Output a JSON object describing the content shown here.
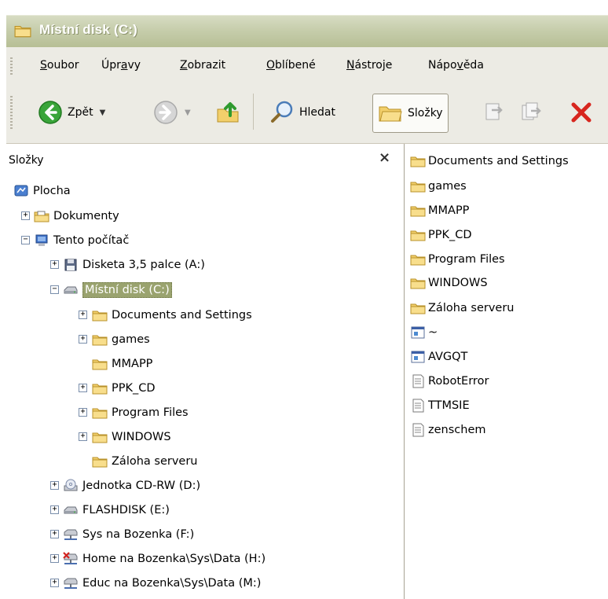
{
  "window": {
    "title": "Místní disk (C:)"
  },
  "menu": [
    {
      "pre": "",
      "u": "S",
      "post": "oubor"
    },
    {
      "pre": "Úpr",
      "u": "a",
      "post": "vy"
    },
    {
      "pre": "",
      "u": "Z",
      "post": "obrazit"
    },
    {
      "pre": "",
      "u": "O",
      "post": "blíbené"
    },
    {
      "pre": "",
      "u": "N",
      "post": "ástroje"
    },
    {
      "pre": "Nápo",
      "u": "v",
      "post": "ěda"
    }
  ],
  "toolbar": {
    "back_label": "Zpět",
    "search_label": "Hledat",
    "folders_label": "Složky"
  },
  "folders_pane": {
    "title": "Složky",
    "close": "×",
    "tree": [
      {
        "label": "Plocha"
      },
      {
        "label": "Dokumenty"
      },
      {
        "label": "Tento počítač"
      },
      {
        "label": "Disketa 3,5 palce (A:)"
      },
      {
        "label": "Místní disk (C:)"
      },
      {
        "label": "Documents and Settings"
      },
      {
        "label": "games"
      },
      {
        "label": "MMAPP"
      },
      {
        "label": "PPK_CD"
      },
      {
        "label": "Program Files"
      },
      {
        "label": "WINDOWS"
      },
      {
        "label": "Záloha serveru"
      },
      {
        "label": "Jednotka CD-RW (D:)"
      },
      {
        "label": "FLASHDISK (E:)"
      },
      {
        "label": "Sys na Bozenka (F:)"
      },
      {
        "label": "Home na Bozenka\\Sys\\Data (H:)"
      },
      {
        "label": "Educ na Bozenka\\Sys\\Data (M:)"
      }
    ]
  },
  "file_list": [
    {
      "label": "Documents and Settings",
      "icon": "folder-icon"
    },
    {
      "label": "games",
      "icon": "folder-icon"
    },
    {
      "label": "MMAPP",
      "icon": "folder-icon"
    },
    {
      "label": "PPK_CD",
      "icon": "folder-icon"
    },
    {
      "label": "Program Files",
      "icon": "folder-icon"
    },
    {
      "label": "WINDOWS",
      "icon": "folder-icon"
    },
    {
      "label": "Záloha serveru",
      "icon": "folder-icon"
    },
    {
      "label": "~",
      "icon": "program-file-icon"
    },
    {
      "label": "AVGQT",
      "icon": "program-file-icon"
    },
    {
      "label": "RobotError",
      "icon": "text-file-icon"
    },
    {
      "label": "TTMSIE",
      "icon": "text-file-icon"
    },
    {
      "label": "zenschem",
      "icon": "text-file-icon"
    }
  ],
  "colors": {
    "selection": "#9aa36f",
    "titlebar": "#c6cdab",
    "chrome": "#ecebe4",
    "folder": "#f2cf6b"
  }
}
